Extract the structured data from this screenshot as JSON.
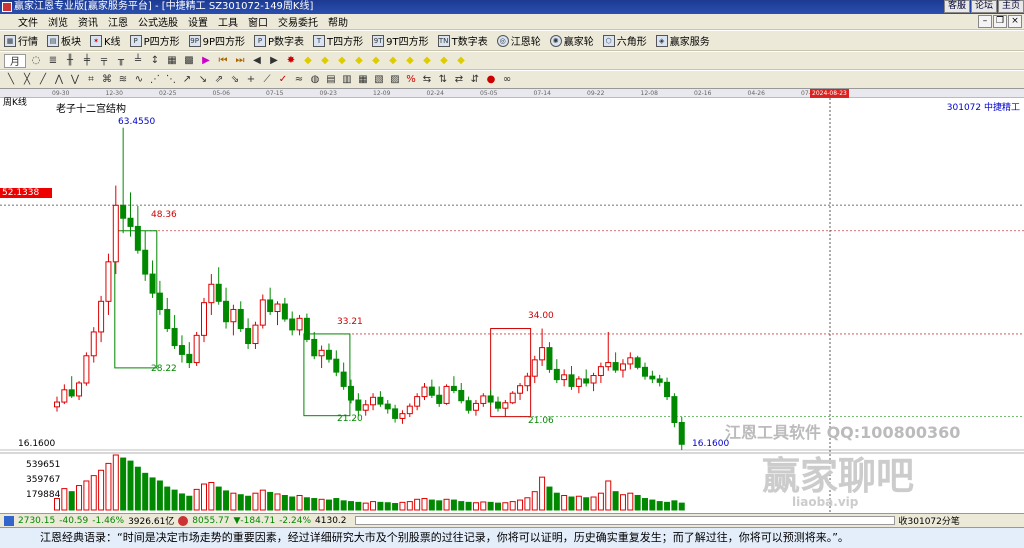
{
  "window": {
    "title": "赢家江恩专业版[赢家服务平台] - [中捷精工  SZ301072-149周K线]",
    "top_links": [
      "客服",
      "论坛",
      "主页"
    ]
  },
  "menu": [
    "文件",
    "浏览",
    "资讯",
    "江恩",
    "公式选股",
    "设置",
    "工具",
    "窗口",
    "交易委托",
    "帮助"
  ],
  "toolbar_main": [
    {
      "label": "行情",
      "icon": "quote-icon"
    },
    {
      "label": "板块",
      "icon": "sector-icon"
    },
    {
      "label": "K线",
      "icon": "kline-icon"
    },
    {
      "label": "P四方形",
      "icon": "p-square-icon"
    },
    {
      "label": "9P四方形",
      "icon": "9p-square-icon"
    },
    {
      "label": "P数字表",
      "icon": "p-table-icon"
    },
    {
      "label": "T四方形",
      "icon": "t-square-icon"
    },
    {
      "label": "9T四方形",
      "icon": "9t-square-icon"
    },
    {
      "label": "T数字表",
      "icon": "t-table-icon"
    },
    {
      "label": "江恩轮",
      "icon": "gann-wheel-icon"
    },
    {
      "label": "赢家轮",
      "icon": "winner-wheel-icon"
    },
    {
      "label": "六角形",
      "icon": "hexagon-icon"
    },
    {
      "label": "赢家服务",
      "icon": "service-icon"
    }
  ],
  "period_selector": "月",
  "chart": {
    "period_label": "周K线",
    "pattern_label": "老子十二宫结构",
    "code_name": "301072  中捷精工",
    "current_price_tag": "52.1338",
    "low_axis_value": "16.1600",
    "time_labels": [
      "09-30",
      "12-30",
      "02-25",
      "05-06",
      "07-15",
      "09-23",
      "12-09",
      "02-24",
      "05-05",
      "07-14",
      "09-22",
      "12-08",
      "02-16",
      "04-26",
      "07-05"
    ],
    "cursor_date": "2024-08-23",
    "annotations": [
      "63.4550",
      "48.36",
      "28.22",
      "33.21",
      "21.20",
      "34.00",
      "21.06",
      "16.1600"
    ],
    "volume_axis": [
      "539651",
      "359767",
      "179884"
    ],
    "watermark": {
      "line1": "江恩工具软件  QQ:100800360",
      "line2": "赢家聊吧",
      "line3": "liaoba.vip"
    }
  },
  "chart_data": {
    "type": "candlestick",
    "x_start": "2021-09-30",
    "x_end": "2024-08-23",
    "ylim": [
      16.16,
      63.455
    ],
    "ohlc": [
      [
        22.5,
        24.0,
        21.8,
        23.2
      ],
      [
        23.2,
        25.8,
        22.9,
        25.0
      ],
      [
        25.0,
        27.0,
        23.8,
        24.1
      ],
      [
        24.1,
        26.3,
        23.5,
        26.0
      ],
      [
        26.0,
        30.5,
        25.6,
        30.0
      ],
      [
        30.0,
        34.2,
        29.0,
        33.5
      ],
      [
        33.5,
        38.8,
        32.0,
        38.0
      ],
      [
        38.0,
        45.0,
        36.0,
        43.8
      ],
      [
        43.8,
        55.0,
        42.0,
        52.1
      ],
      [
        52.1,
        63.5,
        48.0,
        50.2
      ],
      [
        50.2,
        54.0,
        47.5,
        49.0
      ],
      [
        49.0,
        52.0,
        45.0,
        45.5
      ],
      [
        45.5,
        48.4,
        41.0,
        42.0
      ],
      [
        42.0,
        44.0,
        38.5,
        39.2
      ],
      [
        39.2,
        41.0,
        36.0,
        36.8
      ],
      [
        36.8,
        38.5,
        33.5,
        34.0
      ],
      [
        34.0,
        36.0,
        31.0,
        31.5
      ],
      [
        31.5,
        33.0,
        29.0,
        30.2
      ],
      [
        30.2,
        32.0,
        28.2,
        29.0
      ],
      [
        29.0,
        33.5,
        28.5,
        33.0
      ],
      [
        33.0,
        38.5,
        32.0,
        37.8
      ],
      [
        37.8,
        42.0,
        36.0,
        40.5
      ],
      [
        40.5,
        43.0,
        37.5,
        38.0
      ],
      [
        38.0,
        40.0,
        34.0,
        35.0
      ],
      [
        35.0,
        37.5,
        33.0,
        36.8
      ],
      [
        36.8,
        38.0,
        33.5,
        34.0
      ],
      [
        34.0,
        35.5,
        31.0,
        31.8
      ],
      [
        31.8,
        35.0,
        31.0,
        34.5
      ],
      [
        34.5,
        39.0,
        34.0,
        38.2
      ],
      [
        38.2,
        40.0,
        36.0,
        36.5
      ],
      [
        36.5,
        38.0,
        34.5,
        37.6
      ],
      [
        37.6,
        38.5,
        35.0,
        35.4
      ],
      [
        35.4,
        36.5,
        33.0,
        33.8
      ],
      [
        33.8,
        36.0,
        33.0,
        35.5
      ],
      [
        35.5,
        36.2,
        32.0,
        32.4
      ],
      [
        32.4,
        33.5,
        29.5,
        30.0
      ],
      [
        30.0,
        31.5,
        28.2,
        30.8
      ],
      [
        30.8,
        31.8,
        29.0,
        29.5
      ],
      [
        29.5,
        30.8,
        27.0,
        27.6
      ],
      [
        27.6,
        29.0,
        25.0,
        25.5
      ],
      [
        25.5,
        26.5,
        23.0,
        23.5
      ],
      [
        23.5,
        24.5,
        21.2,
        22.0
      ],
      [
        22.0,
        23.5,
        21.2,
        22.8
      ],
      [
        22.8,
        24.5,
        22.0,
        23.9
      ],
      [
        23.9,
        24.8,
        22.5,
        22.9
      ],
      [
        22.9,
        23.5,
        21.5,
        22.2
      ],
      [
        22.2,
        22.8,
        20.2,
        20.8
      ],
      [
        20.8,
        22.0,
        20.0,
        21.5
      ],
      [
        21.5,
        23.0,
        21.0,
        22.6
      ],
      [
        22.6,
        24.5,
        22.0,
        24.0
      ],
      [
        24.0,
        26.0,
        23.5,
        25.4
      ],
      [
        25.4,
        26.5,
        23.8,
        24.2
      ],
      [
        24.2,
        25.5,
        22.5,
        23.0
      ],
      [
        23.0,
        25.8,
        22.8,
        25.5
      ],
      [
        25.5,
        27.0,
        24.5,
        24.9
      ],
      [
        24.9,
        26.0,
        23.0,
        23.4
      ],
      [
        23.4,
        24.0,
        21.5,
        22.0
      ],
      [
        22.0,
        23.5,
        21.2,
        23.0
      ],
      [
        23.0,
        24.5,
        22.5,
        24.1
      ],
      [
        24.1,
        25.0,
        22.8,
        23.2
      ],
      [
        23.2,
        24.0,
        21.8,
        22.3
      ],
      [
        22.3,
        23.5,
        21.06,
        23.1
      ],
      [
        23.1,
        24.8,
        22.9,
        24.5
      ],
      [
        24.5,
        26.0,
        23.5,
        25.6
      ],
      [
        25.6,
        27.5,
        24.8,
        27.0
      ],
      [
        27.0,
        30.0,
        26.0,
        29.4
      ],
      [
        29.4,
        34.0,
        28.5,
        31.2
      ],
      [
        31.2,
        32.0,
        27.5,
        28.0
      ],
      [
        28.0,
        29.5,
        26.0,
        26.5
      ],
      [
        26.5,
        28.0,
        25.5,
        27.2
      ],
      [
        27.2,
        28.5,
        25.0,
        25.5
      ],
      [
        25.5,
        27.0,
        24.5,
        26.6
      ],
      [
        26.6,
        28.0,
        25.5,
        26.0
      ],
      [
        26.0,
        27.5,
        24.8,
        27.1
      ],
      [
        27.1,
        29.0,
        26.0,
        28.4
      ],
      [
        28.4,
        33.5,
        27.8,
        29.0
      ],
      [
        29.0,
        30.5,
        27.5,
        27.9
      ],
      [
        27.9,
        29.5,
        26.8,
        28.8
      ],
      [
        28.8,
        30.5,
        28.0,
        29.7
      ],
      [
        29.7,
        30.0,
        28.0,
        28.3
      ],
      [
        28.3,
        29.0,
        26.5,
        27.0
      ],
      [
        27.0,
        27.8,
        26.0,
        26.6
      ],
      [
        26.6,
        27.2,
        25.5,
        26.1
      ],
      [
        26.1,
        26.8,
        23.5,
        24.0
      ],
      [
        24.0,
        24.5,
        19.5,
        20.2
      ],
      [
        20.2,
        21.0,
        16.16,
        17.0
      ]
    ],
    "volume": [
      150,
      280,
      240,
      320,
      380,
      450,
      520,
      610,
      720,
      680,
      640,
      560,
      480,
      420,
      380,
      300,
      260,
      210,
      180,
      270,
      340,
      360,
      300,
      250,
      220,
      200,
      180,
      220,
      260,
      230,
      210,
      190,
      170,
      190,
      160,
      150,
      140,
      130,
      150,
      120,
      110,
      100,
      90,
      110,
      100,
      95,
      85,
      100,
      110,
      140,
      150,
      130,
      120,
      140,
      130,
      110,
      100,
      95,
      105,
      100,
      90,
      95,
      110,
      130,
      160,
      240,
      430,
      300,
      220,
      190,
      170,
      180,
      160,
      170,
      220,
      380,
      240,
      200,
      220,
      190,
      150,
      130,
      110,
      100,
      120,
      90
    ]
  },
  "status": {
    "sh": "2730.15",
    "sh_chg": "-40.59",
    "sh_pct": "-1.46%",
    "sh_amt": "3926.61亿",
    "sz": "8055.77",
    "sz_chg": "▼-184.71",
    "sz_pct": "-2.24%",
    "sz_amt": "4130.2",
    "right": "收301072分笔"
  },
  "quote_text": "江恩经典语录：“时间是决定市场走势的重要因素，经过详细研究大市及个别股票的过往记录，你将可以证明，历史确实重复发生；而了解过往，你将可以预测将来。”。"
}
